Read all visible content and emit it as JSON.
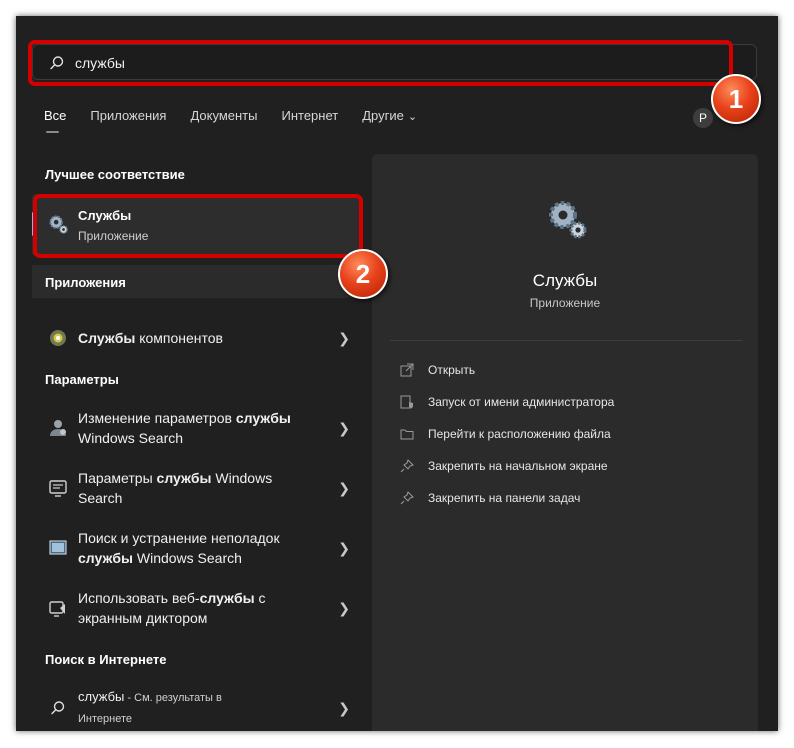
{
  "search": {
    "value": "службы"
  },
  "markers": [
    "1",
    "2"
  ],
  "tabs": [
    "Все",
    "Приложения",
    "Документы",
    "Интернет",
    "Другие"
  ],
  "user_initial": "P",
  "sections": {
    "best_match": "Лучшее соответствие",
    "apps": "Приложения",
    "settings": "Параметры",
    "web": "Поиск в Интернете"
  },
  "best": {
    "title": "Службы",
    "subtitle": "Приложение"
  },
  "apps_item": {
    "bold": "Службы",
    "rest": " компонентов"
  },
  "settings_items": [
    {
      "pre": "Изменение параметров ",
      "bold": "службы",
      "post": "",
      "line2": "Windows Search"
    },
    {
      "pre": "Параметры ",
      "bold": "службы",
      "post": " Windows",
      "line2": "Search"
    },
    {
      "pre": "Поиск и устранение неполадок",
      "bold": "",
      "post": "",
      "line2bold": "службы",
      "line2": " Windows Search"
    },
    {
      "pre": "Использовать веб-",
      "bold": "службы",
      "post": " с",
      "line2": "экранным диктором"
    }
  ],
  "web_item": {
    "query": "службы",
    "suffix": " - См. результаты в",
    "line2": "Интернете"
  },
  "detail": {
    "title": "Службы",
    "subtitle": "Приложение",
    "actions": [
      "Открыть",
      "Запуск от имени администратора",
      "Перейти к расположению файла",
      "Закрепить на начальном экране",
      "Закрепить на панели задач"
    ]
  },
  "colors": {
    "highlight": "#d40000",
    "badge": "#e8421c",
    "accent": "#8ab4f8"
  }
}
